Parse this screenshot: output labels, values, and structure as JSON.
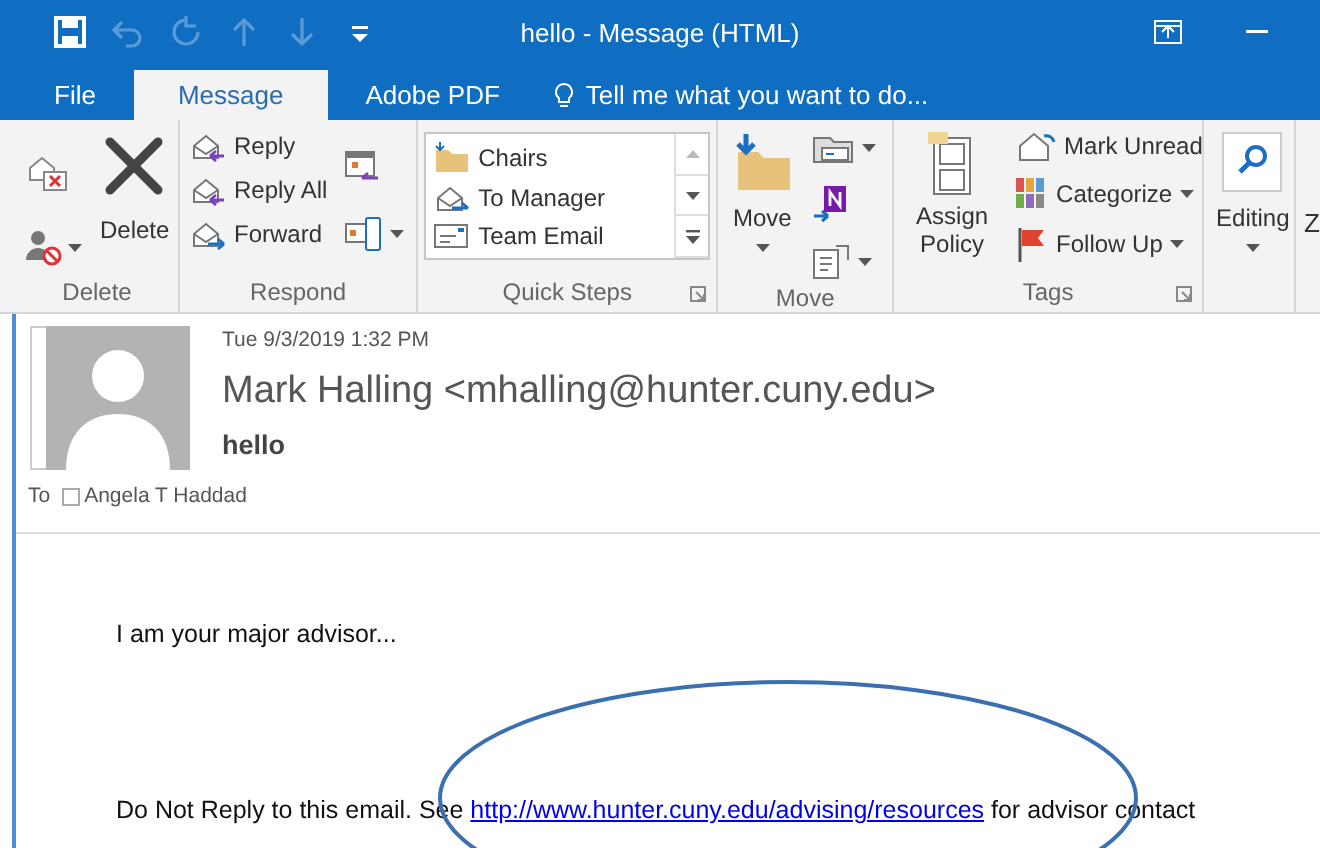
{
  "title_bar": {
    "quick_access": [
      {
        "kind": "save",
        "disabled": false
      },
      {
        "kind": "undo",
        "disabled": true
      },
      {
        "kind": "redo",
        "disabled": true
      },
      {
        "kind": "up",
        "disabled": true
      },
      {
        "kind": "down",
        "disabled": true
      },
      {
        "kind": "customize",
        "disabled": false
      }
    ],
    "title": "hello - Message (HTML)"
  },
  "tabs": [
    {
      "label": "File",
      "selected": false
    },
    {
      "label": "Message",
      "selected": true
    },
    {
      "label": "Adobe PDF",
      "selected": false
    }
  ],
  "tell_me": "Tell me what you want to do...",
  "ribbon": {
    "groups": [
      {
        "kind": "delete",
        "label": "Delete",
        "buttons": [
          {
            "kind": "ignore"
          },
          {
            "kind": "junk"
          },
          {
            "kind": "delete",
            "label": "Delete"
          }
        ]
      },
      {
        "kind": "respond",
        "label": "Respond",
        "buttons": [
          {
            "kind": "reply",
            "label": "Reply"
          },
          {
            "kind": "reply_all",
            "label": "Reply All"
          },
          {
            "kind": "forward",
            "label": "Forward"
          },
          {
            "kind": "meeting"
          },
          {
            "kind": "more"
          }
        ]
      },
      {
        "kind": "quick_steps",
        "label": "Quick Steps",
        "buttons": [
          {
            "kind": "folder",
            "label": "Chairs"
          },
          {
            "kind": "manager",
            "label": "To Manager"
          },
          {
            "kind": "team",
            "label": "Team Email"
          }
        ]
      },
      {
        "kind": "move",
        "label": "Move",
        "buttons": [
          {
            "kind": "move",
            "label": "Move"
          },
          {
            "kind": "rules"
          },
          {
            "kind": "onenote"
          },
          {
            "kind": "actions"
          }
        ]
      },
      {
        "kind": "tags",
        "label": "Tags",
        "buttons": [
          {
            "kind": "policy",
            "label": "Assign Policy"
          },
          {
            "kind": "unread",
            "label": "Mark Unread"
          },
          {
            "kind": "categorize",
            "label": "Categorize"
          },
          {
            "kind": "follow_up",
            "label": "Follow Up"
          }
        ]
      },
      {
        "kind": "editing",
        "buttons": [
          {
            "kind": "editing",
            "label": "Editing"
          }
        ]
      }
    ],
    "cut_group": "Z"
  },
  "message": {
    "date": "Tue 9/3/2019 1:32 PM",
    "sender": "Mark Halling <mhalling@hunter.cuny.edu>",
    "subject": "hello",
    "to_label": "To",
    "recipients": [
      {
        "name": "Angela T Haddad"
      }
    ],
    "body": [
      {
        "text": "I am your major advisor..."
      },
      {
        "text": "Do Not Reply to this email. See ",
        "link": "http://www.hunter.cuny.edu/advising/resources",
        "after": " for advisor contact"
      }
    ]
  }
}
